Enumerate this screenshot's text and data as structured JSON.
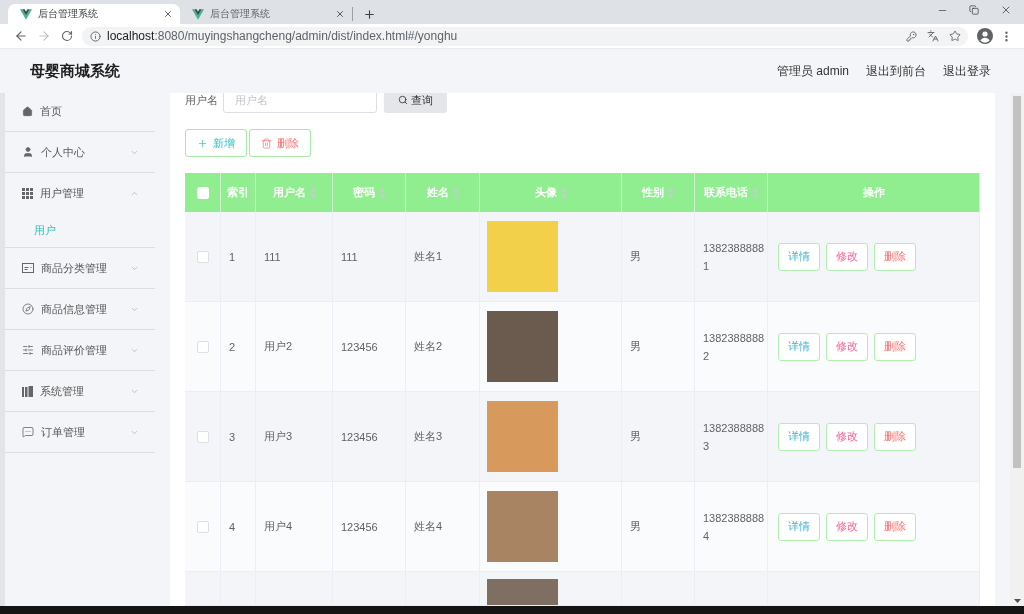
{
  "browser": {
    "tabs": [
      {
        "title": "后台管理系统",
        "selected": true
      },
      {
        "title": "后台管理系统",
        "selected": false
      }
    ],
    "back": {
      "disabled": false
    },
    "forward": {
      "disabled": true
    },
    "url": {
      "host": "localhost",
      "path": ":8080/muyingshangcheng/admin/dist/index.html#/yonghu"
    }
  },
  "header": {
    "title": "母婴商城系统",
    "links": [
      "管理员 admin",
      "退出到前台",
      "退出登录"
    ]
  },
  "sidebar": {
    "items": [
      {
        "label": "首页",
        "kind": "link",
        "selected": false
      },
      {
        "label": "个人中心",
        "kind": "submenu",
        "selected": false,
        "expanded": false
      },
      {
        "label": "用户管理",
        "kind": "submenu",
        "selected": false,
        "expanded": true,
        "children": [
          {
            "label": "用户",
            "selected": true
          }
        ]
      },
      {
        "label": "商品分类管理",
        "kind": "submenu",
        "selected": false,
        "expanded": false
      },
      {
        "label": "商品信息管理",
        "kind": "submenu",
        "selected": false,
        "expanded": false
      },
      {
        "label": "商品评价管理",
        "kind": "submenu",
        "selected": false,
        "expanded": false
      },
      {
        "label": "系统管理",
        "kind": "submenu",
        "selected": false,
        "expanded": false
      },
      {
        "label": "订单管理",
        "kind": "submenu",
        "selected": false,
        "expanded": false
      }
    ]
  },
  "search": {
    "label": "用户名",
    "placeholder": "用户名",
    "button": "查询"
  },
  "toolbar": [
    {
      "kind": "add",
      "label": "新增"
    },
    {
      "kind": "delete",
      "label": "删除"
    }
  ],
  "table": {
    "select_all": {
      "checked": false
    },
    "columns": [
      {
        "label": "索引",
        "sortable": false
      },
      {
        "label": "用户名",
        "sortable": true
      },
      {
        "label": "密码",
        "sortable": true
      },
      {
        "label": "姓名",
        "sortable": true
      },
      {
        "label": "头像",
        "sortable": true
      },
      {
        "label": "性别",
        "sortable": true
      },
      {
        "label": "联系电话",
        "sortable": true
      },
      {
        "label": "操作",
        "sortable": false
      }
    ],
    "rows": [
      {
        "checked": false,
        "index": "1",
        "username": "111",
        "password": "111",
        "name": "姓名1",
        "gender": "男",
        "phone": "13823888881",
        "actions": [
          {
            "kind": "detail",
            "label": "详情"
          },
          {
            "kind": "edit",
            "label": "修改"
          },
          {
            "kind": "delete",
            "label": "删除"
          }
        ]
      },
      {
        "checked": false,
        "index": "2",
        "username": "用户2",
        "password": "123456",
        "name": "姓名2",
        "gender": "男",
        "phone": "13823888882",
        "actions": [
          {
            "kind": "detail",
            "label": "详情"
          },
          {
            "kind": "edit",
            "label": "修改"
          },
          {
            "kind": "delete",
            "label": "删除"
          }
        ]
      },
      {
        "checked": false,
        "index": "3",
        "username": "用户3",
        "password": "123456",
        "name": "姓名3",
        "gender": "男",
        "phone": "13823888883",
        "actions": [
          {
            "kind": "detail",
            "label": "详情"
          },
          {
            "kind": "edit",
            "label": "修改"
          },
          {
            "kind": "delete",
            "label": "删除"
          }
        ]
      },
      {
        "checked": false,
        "index": "4",
        "username": "用户4",
        "password": "123456",
        "name": "姓名4",
        "gender": "男",
        "phone": "13823888884",
        "actions": [
          {
            "kind": "detail",
            "label": "详情"
          },
          {
            "kind": "edit",
            "label": "修改"
          },
          {
            "kind": "delete",
            "label": "删除"
          }
        ]
      }
    ]
  }
}
